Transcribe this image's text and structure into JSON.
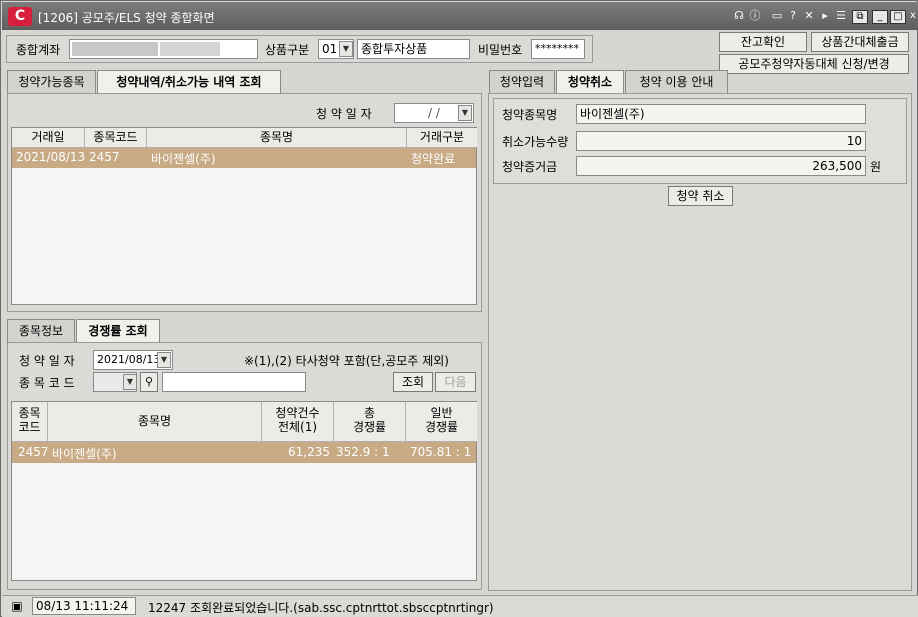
{
  "window": {
    "title": "[1206] 공모주/ELS 청약 종합화면",
    "icon_text": "C"
  },
  "titlebar_icons": [
    "headset-icon",
    "info-icon",
    "chat-icon",
    "help-icon",
    "link-icon",
    "play-icon",
    "list-icon"
  ],
  "window_buttons": {
    "restore": "⧉",
    "minimize": "_",
    "maximize": "□",
    "close": "x"
  },
  "header": {
    "account_label": "종합계좌",
    "product_label": "상품구분",
    "product_code": "01",
    "product_name": "종합투자상품",
    "password_label": "비밀번호",
    "password_value": "********",
    "btn_balance": "잔고확인",
    "btn_substitute": "상품간대체출금",
    "btn_auto": "공모주청약자동대체 신청/변경"
  },
  "left_top": {
    "tabs": [
      "청약가능종목",
      "청약내역/취소가능 내역 조회"
    ],
    "date_label": "청 약 일 자",
    "date_value": "/ /",
    "columns": [
      "거래일",
      "종목코드",
      "종목명",
      "거래구분"
    ],
    "rows": [
      [
        "2021/08/13",
        "2457",
        "바이젠셀(주)",
        "청약완료"
      ]
    ]
  },
  "left_bottom": {
    "tabs": [
      "종목정보",
      "경쟁률 조회"
    ],
    "date_label": "청 약 일 자",
    "date_value": "2021/08/13",
    "note": "※(1),(2) 타사청약 포함(단,공모주 제외)",
    "code_label": "종 목 코 드",
    "btn_search": "조회",
    "btn_next": "다음",
    "columns": [
      "종목\n코드",
      "종목명",
      "청약건수\n전체(1)",
      "총\n경쟁률",
      "일반\n경쟁률"
    ],
    "rows": [
      [
        "2457",
        "바이젠셀(주)",
        "61,235",
        "352.9 : 1",
        "705.81 : 1"
      ]
    ]
  },
  "right": {
    "tabs": [
      "청약입력",
      "청약취소",
      "청약 이용 안내"
    ],
    "name_label": "청약종목명",
    "name_value": "바이젠셀(주)",
    "qty_label": "취소가능수량",
    "qty_value": "10",
    "deposit_label": "청약증거금",
    "deposit_value": "263,500",
    "deposit_unit": "원",
    "btn_cancel": "청약 취소"
  },
  "status": {
    "datetime": "08/13  11:11:24",
    "message": "12247 조회완료되었습니다.(sab.ssc.cptnrttot.sbsccptnrtingr)"
  },
  "colors": {
    "accent": "#d81f3d",
    "selected_row": "#c8ab85",
    "titlebar": "#6e6e6e"
  }
}
